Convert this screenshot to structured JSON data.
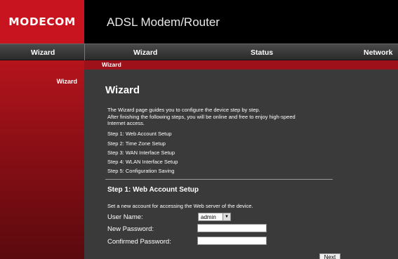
{
  "header": {
    "logo": "MODECOM",
    "product_title": "ADSL Modem/Router"
  },
  "nav": {
    "section_label": "Wizard",
    "items": [
      {
        "label": "Wizard"
      },
      {
        "label": "Status"
      },
      {
        "label": "Network"
      }
    ]
  },
  "sidebar": {
    "items": [
      {
        "label": "Wizard"
      }
    ]
  },
  "breadcrumb": "Wizard",
  "main": {
    "title": "Wizard",
    "intro_lines": [
      "The Wizard page guides you to configure the device step by step.",
      "After finishing the following steps, you will be online and free to enjoy high-speed",
      "Internet access."
    ],
    "steps": [
      "Step 1: Web Account Setup",
      "Step 2: Time Zone Setup",
      "Step 3: WAN Interface Setup",
      "Step 4: WLAN Interface Setup",
      "Step 5: Configuration Saving"
    ],
    "section_title": "Step 1: Web Account Setup",
    "section_desc": "Set a new account for accessing the Web server of the device.",
    "form": {
      "user_name_label": "User Name:",
      "user_name_value": "admin",
      "new_password_label": "New Password:",
      "new_password_value": "",
      "confirm_password_label": "Confirmed Password:",
      "confirm_password_value": ""
    },
    "next_label": "Next"
  },
  "colors": {
    "brand_red": "#c8141e",
    "content_bg": "#3a3a3a"
  }
}
